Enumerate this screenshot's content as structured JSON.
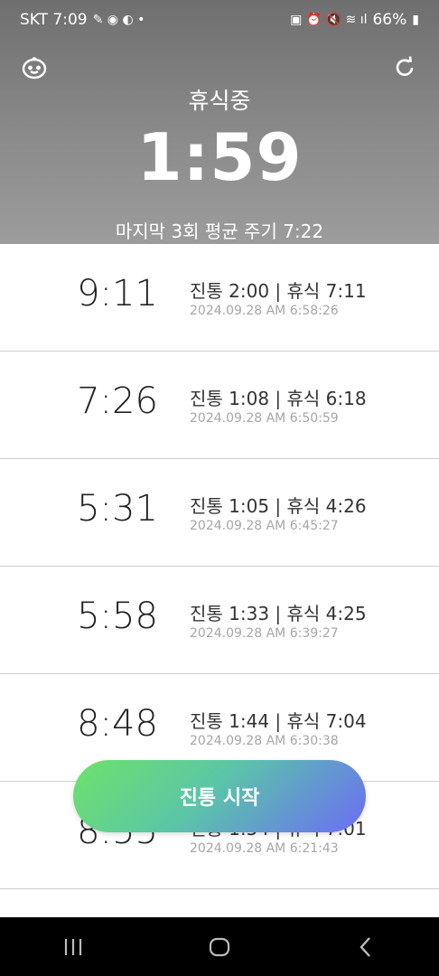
{
  "status_bar": {
    "carrier_time": "SKT 7:09",
    "battery": "66%"
  },
  "header": {
    "state_label": "휴식중",
    "timer": "1:59",
    "average_text": "마지막 3회 평균 주기 7:22"
  },
  "records": [
    {
      "interval": "9:11",
      "detail": "진통 2:00 | 휴식 7:11",
      "timestamp": "2024.09.28 AM 6:58:26"
    },
    {
      "interval": "7:26",
      "detail": "진통 1:08 | 휴식 6:18",
      "timestamp": "2024.09.28 AM 6:50:59"
    },
    {
      "interval": "5:31",
      "detail": "진통 1:05 | 휴식 4:26",
      "timestamp": "2024.09.28 AM 6:45:27"
    },
    {
      "interval": "5:58",
      "detail": "진통 1:33 | 휴식 4:25",
      "timestamp": "2024.09.28 AM 6:39:27"
    },
    {
      "interval": "8:48",
      "detail": "진통 1:44 | 휴식 7:04",
      "timestamp": "2024.09.28 AM 6:30:38"
    },
    {
      "interval": "8:55",
      "detail": "진통 1:54 | 휴식 7:01",
      "timestamp": "2024.09.28 AM 6:21:43"
    }
  ],
  "start_button": {
    "label": "진통 시작"
  },
  "icons": {
    "left_header": "baby-face-icon",
    "right_header": "refresh-icon"
  },
  "colors": {
    "header_bg": "#8a8a8a",
    "button_gradient_start": "#6ee26a",
    "button_gradient_end": "#6b6cf5"
  }
}
